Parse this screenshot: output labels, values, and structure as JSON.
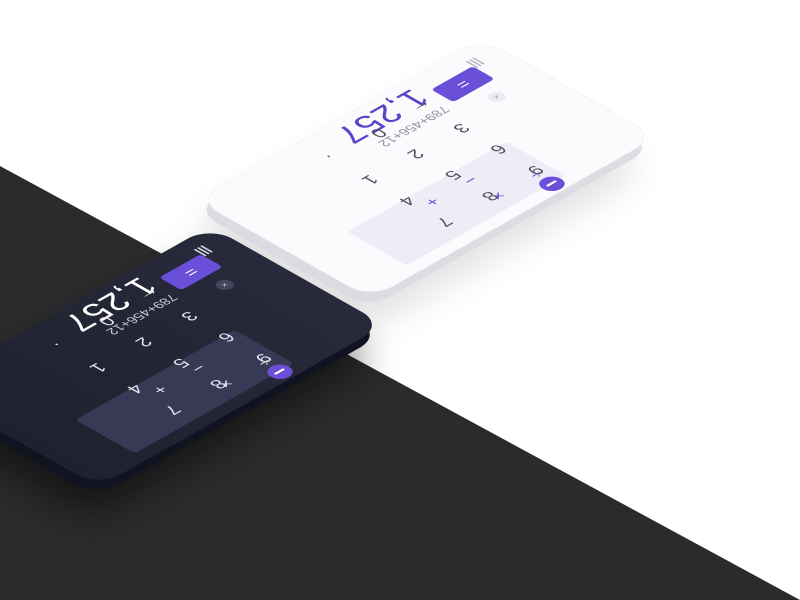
{
  "light_calculator": {
    "theme": "light",
    "expression": "789+456+12",
    "result": "1,257",
    "clear_label": "×",
    "digits": [
      "9",
      "8",
      "7",
      "6",
      "5",
      "4",
      "3",
      "2",
      "1",
      "0",
      "."
    ],
    "operators": [
      "÷",
      "×",
      "−",
      "+"
    ],
    "backspace_label": "←",
    "equals_label": "=",
    "menu_icon": "menu-icon",
    "accent_color": "#6a4fd9"
  },
  "dark_calculator": {
    "theme": "dark",
    "expression": "789+456+12",
    "result": "1,257",
    "clear_label": "×",
    "digits": [
      "9",
      "8",
      "7",
      "6",
      "5",
      "4",
      "3",
      "2",
      "1",
      "0",
      "."
    ],
    "operators": [
      "÷",
      "×",
      "−",
      "+"
    ],
    "backspace_label": "←",
    "equals_label": "=",
    "menu_icon": "menu-icon",
    "accent_color": "#6a4fd9"
  }
}
